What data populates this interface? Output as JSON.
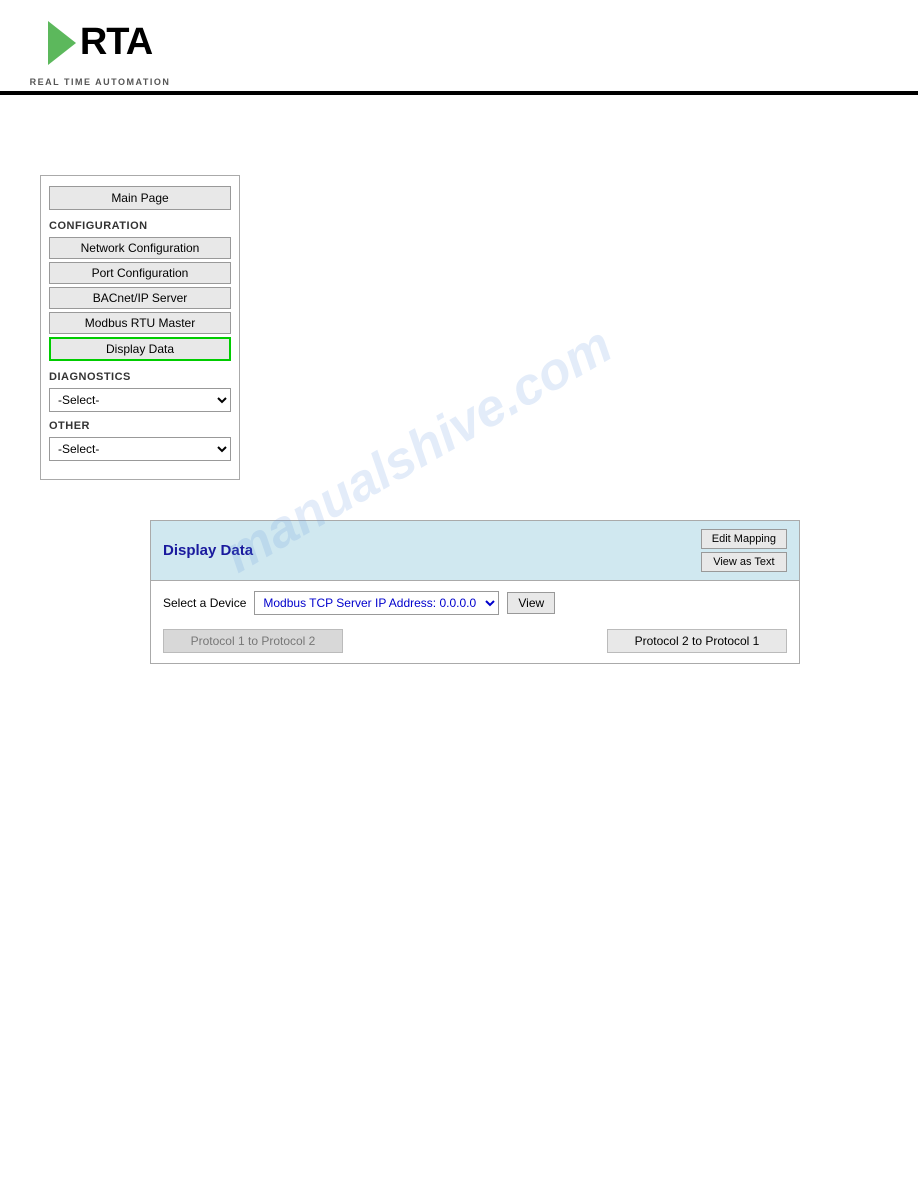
{
  "header": {
    "logo_rta": "RTA",
    "logo_subtitle": "REAL TIME AUTOMATION"
  },
  "nav": {
    "main_page_label": "Main Page",
    "configuration_label": "CONFIGURATION",
    "network_config_label": "Network Configuration",
    "port_config_label": "Port Configuration",
    "bacnet_label": "BACnet/IP Server",
    "modbus_label": "Modbus RTU Master",
    "display_data_label": "Display Data",
    "diagnostics_label": "DIAGNOSTICS",
    "diagnostics_select_default": "-Select-",
    "other_label": "OTHER",
    "other_select_default": "-Select-"
  },
  "display_data": {
    "title": "Display Data",
    "edit_mapping_label": "Edit Mapping",
    "view_as_text_label": "View as Text",
    "select_device_label": "Select a Device",
    "device_option": "Modbus TCP Server IP Address: 0.0.0.0",
    "view_btn_label": "View",
    "protocol1_to_2_label": "Protocol 1 to Protocol 2",
    "protocol2_to_1_label": "Protocol 2 to Protocol 1"
  },
  "watermark": {
    "text": "manualshive.com"
  }
}
